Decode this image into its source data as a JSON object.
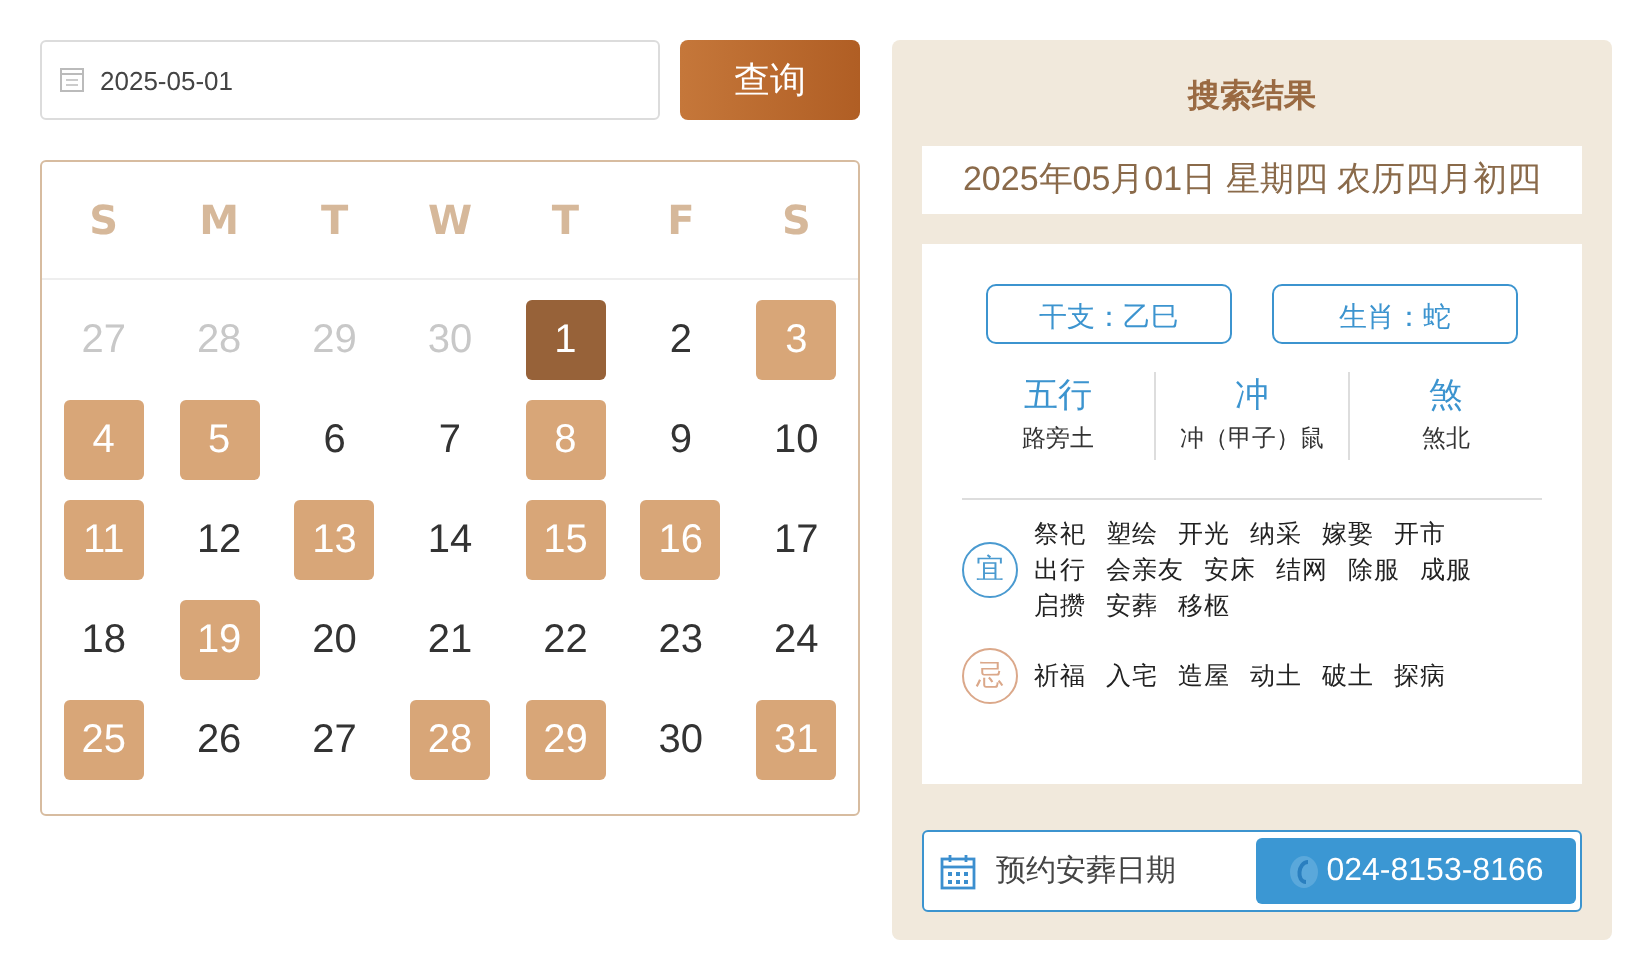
{
  "search": {
    "value": "2025-05-01",
    "button": "查询"
  },
  "calendar": {
    "weekdays": [
      "S",
      "M",
      "T",
      "W",
      "T",
      "F",
      "S"
    ],
    "days": [
      {
        "label": "27",
        "outside": true,
        "marked": false,
        "selected": false
      },
      {
        "label": "28",
        "outside": true,
        "marked": false,
        "selected": false
      },
      {
        "label": "29",
        "outside": true,
        "marked": false,
        "selected": false
      },
      {
        "label": "30",
        "outside": true,
        "marked": false,
        "selected": false
      },
      {
        "label": "1",
        "outside": false,
        "marked": false,
        "selected": true
      },
      {
        "label": "2",
        "outside": false,
        "marked": false,
        "selected": false
      },
      {
        "label": "3",
        "outside": false,
        "marked": true,
        "selected": false
      },
      {
        "label": "4",
        "outside": false,
        "marked": true,
        "selected": false
      },
      {
        "label": "5",
        "outside": false,
        "marked": true,
        "selected": false
      },
      {
        "label": "6",
        "outside": false,
        "marked": false,
        "selected": false
      },
      {
        "label": "7",
        "outside": false,
        "marked": false,
        "selected": false
      },
      {
        "label": "8",
        "outside": false,
        "marked": true,
        "selected": false
      },
      {
        "label": "9",
        "outside": false,
        "marked": false,
        "selected": false
      },
      {
        "label": "10",
        "outside": false,
        "marked": false,
        "selected": false
      },
      {
        "label": "11",
        "outside": false,
        "marked": true,
        "selected": false
      },
      {
        "label": "12",
        "outside": false,
        "marked": false,
        "selected": false
      },
      {
        "label": "13",
        "outside": false,
        "marked": true,
        "selected": false
      },
      {
        "label": "14",
        "outside": false,
        "marked": false,
        "selected": false
      },
      {
        "label": "15",
        "outside": false,
        "marked": true,
        "selected": false
      },
      {
        "label": "16",
        "outside": false,
        "marked": true,
        "selected": false
      },
      {
        "label": "17",
        "outside": false,
        "marked": false,
        "selected": false
      },
      {
        "label": "18",
        "outside": false,
        "marked": false,
        "selected": false
      },
      {
        "label": "19",
        "outside": false,
        "marked": true,
        "selected": false
      },
      {
        "label": "20",
        "outside": false,
        "marked": false,
        "selected": false
      },
      {
        "label": "21",
        "outside": false,
        "marked": false,
        "selected": false
      },
      {
        "label": "22",
        "outside": false,
        "marked": false,
        "selected": false
      },
      {
        "label": "23",
        "outside": false,
        "marked": false,
        "selected": false
      },
      {
        "label": "24",
        "outside": false,
        "marked": false,
        "selected": false
      },
      {
        "label": "25",
        "outside": false,
        "marked": true,
        "selected": false
      },
      {
        "label": "26",
        "outside": false,
        "marked": false,
        "selected": false
      },
      {
        "label": "27",
        "outside": false,
        "marked": false,
        "selected": false
      },
      {
        "label": "28",
        "outside": false,
        "marked": true,
        "selected": false
      },
      {
        "label": "29",
        "outside": false,
        "marked": true,
        "selected": false
      },
      {
        "label": "30",
        "outside": false,
        "marked": false,
        "selected": false
      },
      {
        "label": "31",
        "outside": false,
        "marked": true,
        "selected": false
      }
    ]
  },
  "result": {
    "title": "搜索结果",
    "date": "2025年05月01日 星期四 农历四月初四",
    "tags": [
      "干支：乙巳",
      "生肖：蛇"
    ],
    "facts": [
      {
        "heading": "五行",
        "value": "路旁土"
      },
      {
        "heading": "冲",
        "value": "冲（甲子）鼠"
      },
      {
        "heading": "煞",
        "value": "煞北"
      }
    ],
    "lists": [
      {
        "kind": "good",
        "badge": "宜",
        "items": [
          "祭祀",
          "塑绘",
          "开光",
          "纳采",
          "嫁娶",
          "开市",
          "出行",
          "会亲友",
          "安床",
          "结网",
          "除服",
          "成服",
          "启攒",
          "安葬",
          "移柩"
        ]
      },
      {
        "kind": "bad",
        "badge": "忌",
        "items": [
          "祈福",
          "入宅",
          "造屋",
          "动土",
          "破土",
          "探病"
        ]
      }
    ]
  },
  "booking": {
    "label": "预约安葬日期",
    "phone": "024-8153-8166"
  }
}
